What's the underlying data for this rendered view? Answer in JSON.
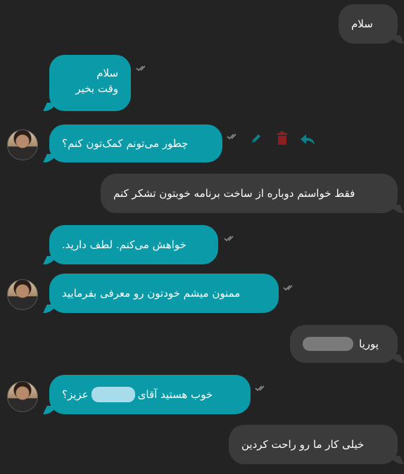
{
  "messages": [
    {
      "text": "سلام",
      "dir": "in"
    },
    {
      "line1": "سلام",
      "line2": "وقت بخیر",
      "dir": "out"
    },
    {
      "text": "چطور می‌تونم کمک‌تون کنم؟",
      "dir": "out"
    },
    {
      "text": "فقط خواستم دوباره از ساخت برنامه خوبتون تشکر کنم",
      "dir": "in"
    },
    {
      "text": "خواهش می‌کنم. لطف دارید.",
      "dir": "out"
    },
    {
      "text": "ممنون میشم خودتون رو معرفی بفرمایید",
      "dir": "out"
    },
    {
      "text": "پوریا",
      "dir": "in"
    },
    {
      "before": "خوب هستید آقای",
      "after": "عزیز؟",
      "dir": "out"
    },
    {
      "text": "خیلی کار ما رو راحت کردین",
      "dir": "in"
    }
  ],
  "colors": {
    "background": "#232323",
    "incoming_bubble": "#3b3b3b",
    "outgoing_bubble": "#0b9aa7",
    "tick": "#8a8a8a",
    "edit_icon": "#0f7f88",
    "delete_icon": "#8b1f1f",
    "reply_icon": "#0f7f88"
  },
  "icons": [
    "double-check-icon",
    "edit-icon",
    "delete-icon",
    "reply-icon",
    "avatar"
  ]
}
